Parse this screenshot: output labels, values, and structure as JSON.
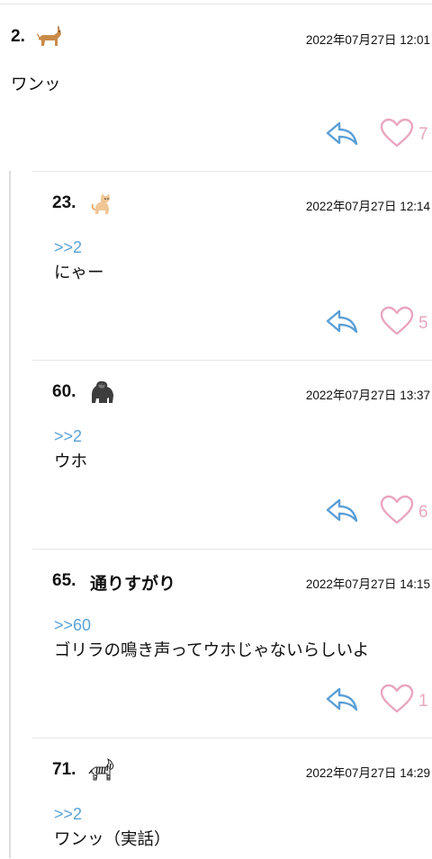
{
  "posts": [
    {
      "number": "2.",
      "avatar": "dog-icon",
      "timestamp": "2022年07月27日 12:01",
      "text": "ワンッ",
      "likes": "7"
    },
    {
      "number": "23.",
      "avatar": "cat-icon",
      "timestamp": "2022年07月27日 12:14",
      "anchor": ">>2",
      "text": "にゃー",
      "likes": "5"
    },
    {
      "number": "60.",
      "avatar": "gorilla-icon",
      "timestamp": "2022年07月27日 13:37",
      "anchor": ">>2",
      "text": "ウホ",
      "likes": "6"
    },
    {
      "number": "65.",
      "name": "通りすがり",
      "timestamp": "2022年07月27日 14:15",
      "anchor": ">>60",
      "text": "ゴリラの鳴き声ってウホじゃないらしいよ",
      "likes": "1"
    },
    {
      "number": "71.",
      "avatar": "zebra-icon",
      "timestamp": "2022年07月27日 14:29",
      "anchor": ">>2",
      "text": "ワンッ（実話）"
    }
  ],
  "colors": {
    "anchor": "#5aa2d6",
    "reply_icon": "#5b9fd6",
    "like_icon": "#e9a6c0"
  }
}
